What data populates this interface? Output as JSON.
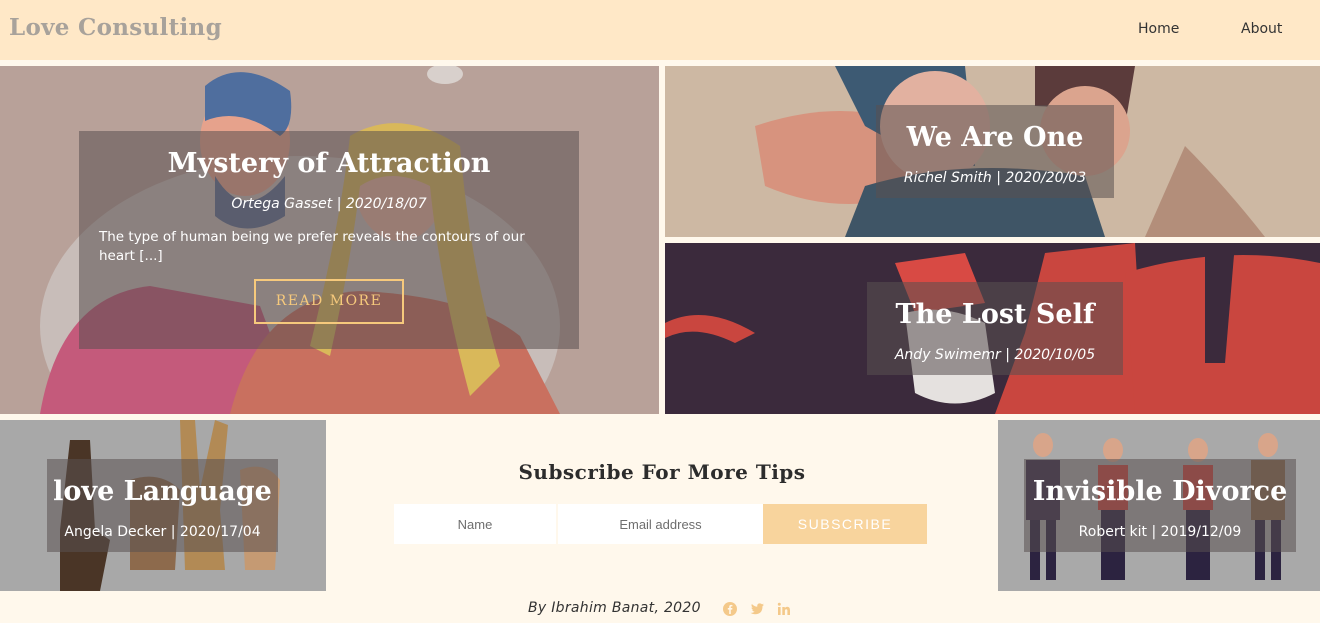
{
  "header": {
    "brand": "Love Consulting",
    "nav": [
      {
        "label": "Home"
      },
      {
        "label": "About"
      }
    ]
  },
  "articles": {
    "mystery": {
      "title": "Mystery of Attraction",
      "meta": "Ortega Gasset | 2020/18/07",
      "excerpt": "The type of human being we prefer reveals the contours of our heart [...]",
      "cta": "READ MORE"
    },
    "we_are_one": {
      "title": "We Are One",
      "meta": "Richel Smith | 2020/20/03"
    },
    "lost_self": {
      "title": "The Lost Self",
      "meta": "Andy Swimemr | 2020/10/05"
    },
    "love_language": {
      "title": "love Language",
      "meta": "Angela Decker | 2020/17/04"
    },
    "invisible_divorce": {
      "title": "Invisible Divorce",
      "meta": "Robert kit | 2019/12/09"
    }
  },
  "subscribe": {
    "title": "Subscribe For More Tips",
    "name_placeholder": "Name",
    "email_placeholder": "Email address",
    "button": "SUBSCRIBE"
  },
  "footer": {
    "credit": "By Ibrahim Banat, 2020",
    "social": [
      "facebook-icon",
      "twitter-icon",
      "linkedin-icon"
    ]
  },
  "colors": {
    "header_bg": "#ffe8c7",
    "page_bg": "#fff8ec",
    "accent": "#f6c97c",
    "button_bg": "#f8d49d",
    "social_icon": "#f4c98a"
  }
}
